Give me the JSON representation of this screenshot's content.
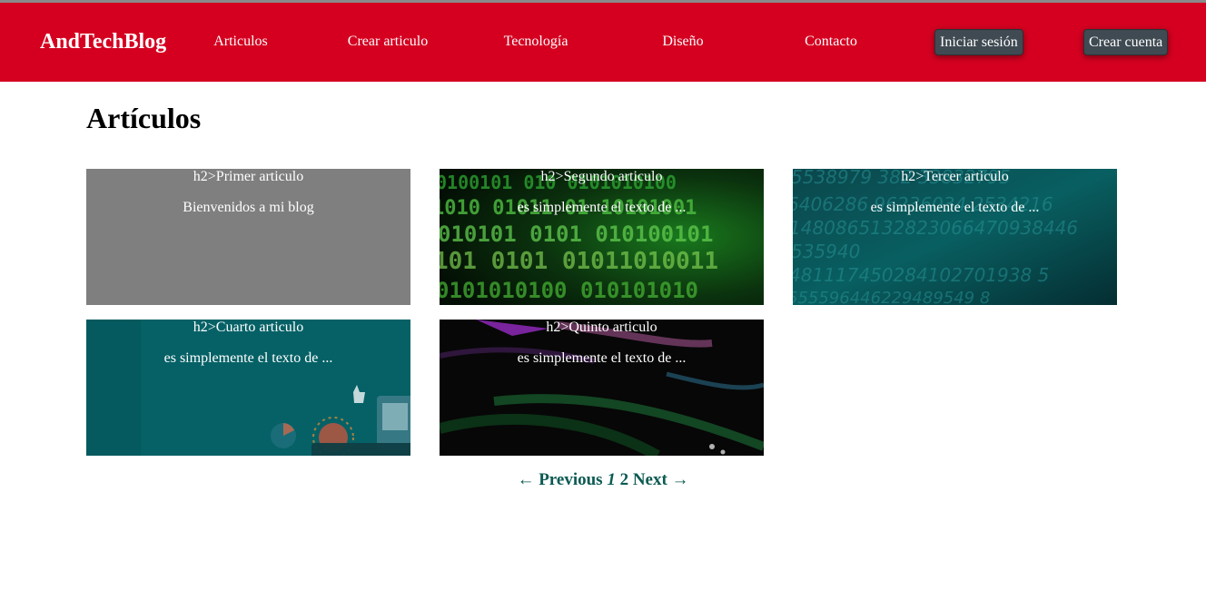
{
  "header": {
    "brand": "AndTechBlog",
    "nav": [
      "Articulos",
      "Crear articulo",
      "Tecnología",
      "Diseño",
      "Contacto"
    ],
    "login_label": "Iniciar sesión",
    "signup_label": "Crear cuenta"
  },
  "main": {
    "title": "Artículos",
    "articles": [
      {
        "title": "h2>Primer articulo",
        "excerpt": "Bienvenidos a mi blog",
        "background": "plain-gray"
      },
      {
        "title": "h2>Segundo articulo",
        "excerpt": "es simplemente el texto de ...",
        "background": "green-binary-code"
      },
      {
        "title": "h2>Tercer articulo",
        "excerpt": "es simplemente el texto de ...",
        "background": "teal-digits"
      },
      {
        "title": "h2>Cuarto articulo",
        "excerpt": "es simplemente el texto de ...",
        "background": "teal-illustration"
      },
      {
        "title": "h2>Quinto articulo",
        "excerpt": "es simplemente el texto de ...",
        "background": "dark-light-streaks"
      }
    ]
  },
  "pagination": {
    "prev_label": "← Previous",
    "pages": [
      "1",
      "2"
    ],
    "current_page": "1",
    "next_label": "Next →"
  },
  "colors": {
    "navbar": "#d50020",
    "button": "#3f4a52",
    "pagination": "#0b5a52",
    "card_gray": "#7f7f7f"
  }
}
